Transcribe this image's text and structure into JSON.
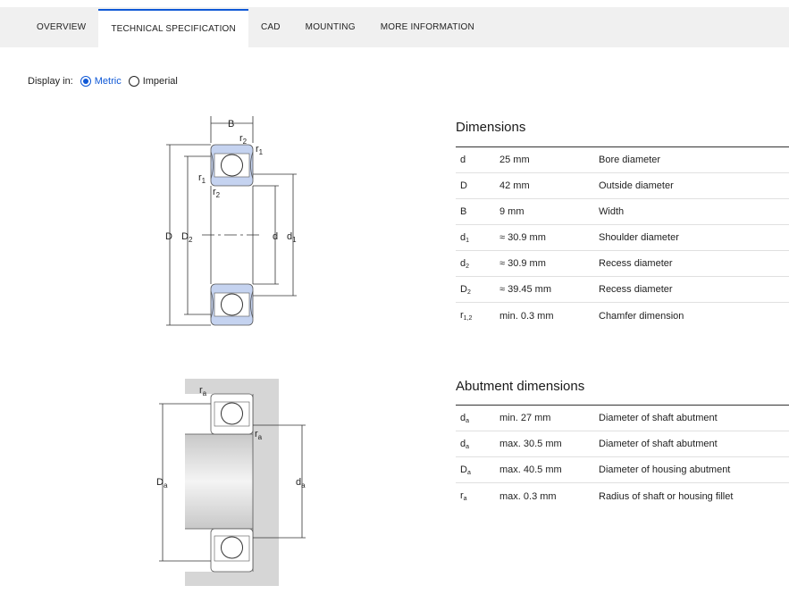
{
  "tabs": [
    {
      "label": "OVERVIEW",
      "active": false
    },
    {
      "label": "TECHNICAL SPECIFICATION",
      "active": true
    },
    {
      "label": "CAD",
      "active": false
    },
    {
      "label": "MOUNTING",
      "active": false
    },
    {
      "label": "MORE INFORMATION",
      "active": false
    }
  ],
  "display": {
    "label": "Display in:",
    "options": [
      {
        "label": "Metric",
        "checked": true
      },
      {
        "label": "Imperial",
        "checked": false
      }
    ]
  },
  "diagram_labels": {
    "B": "B",
    "r": "r",
    "sub1": "1",
    "sub2": "2",
    "D": "D",
    "d": "d",
    "a": "a"
  },
  "dimensions": {
    "title": "Dimensions",
    "rows": [
      {
        "symbol": "d",
        "sub": "",
        "value": "25 mm",
        "desc": "Bore diameter"
      },
      {
        "symbol": "D",
        "sub": "",
        "value": "42 mm",
        "desc": "Outside diameter"
      },
      {
        "symbol": "B",
        "sub": "",
        "value": "9 mm",
        "desc": "Width"
      },
      {
        "symbol": "d",
        "sub": "1",
        "value": "≈ 30.9 mm",
        "desc": "Shoulder diameter"
      },
      {
        "symbol": "d",
        "sub": "2",
        "value": "≈ 30.9 mm",
        "desc": "Recess diameter"
      },
      {
        "symbol": "D",
        "sub": "2",
        "value": "≈ 39.45 mm",
        "desc": "Recess diameter"
      },
      {
        "symbol": "r",
        "sub": "1,2",
        "value": "min. 0.3 mm",
        "desc": "Chamfer dimension"
      }
    ]
  },
  "abutment": {
    "title": "Abutment dimensions",
    "rows": [
      {
        "symbol": "d",
        "sub": "a",
        "value": "min. 27 mm",
        "desc": "Diameter of shaft abutment"
      },
      {
        "symbol": "d",
        "sub": "a",
        "value": "max. 30.5 mm",
        "desc": "Diameter of shaft abutment"
      },
      {
        "symbol": "D",
        "sub": "a",
        "value": "max. 40.5 mm",
        "desc": "Diameter of housing abutment"
      },
      {
        "symbol": "r",
        "sub": "a",
        "value": "max. 0.3 mm",
        "desc": "Radius of shaft or housing fillet"
      }
    ]
  },
  "colors": {
    "accent": "#0f58d6",
    "bearing_fill": "#c5d3f0",
    "housing_fill": "#d6d6d6"
  }
}
